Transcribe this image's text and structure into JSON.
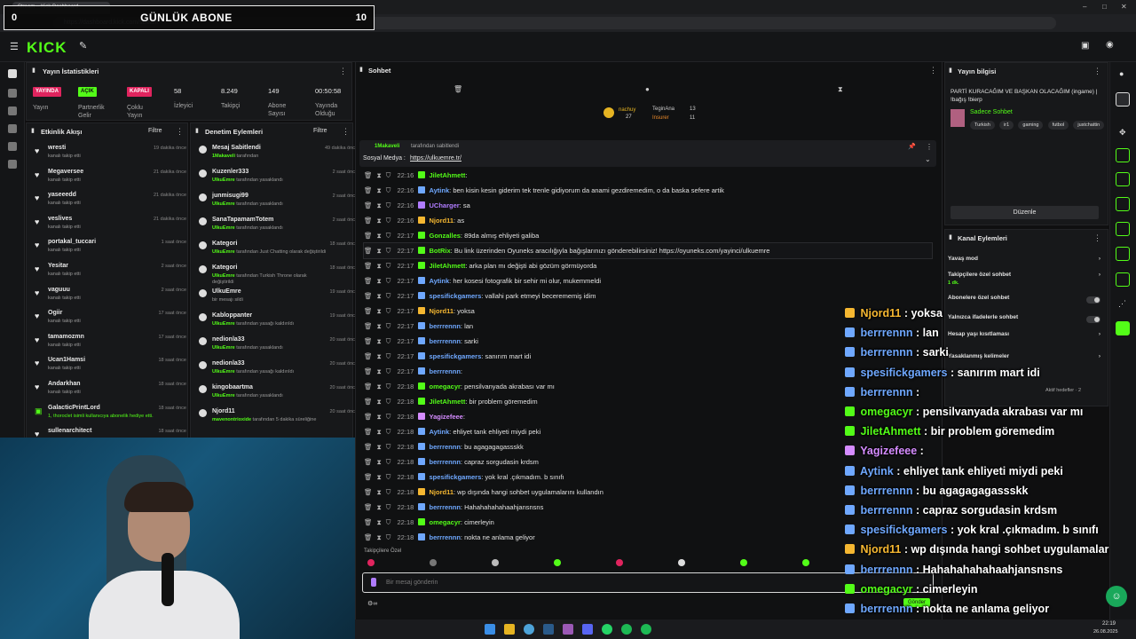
{
  "browser": {
    "tab_title": "Stream – Kick Dashboard",
    "url": "https://dashboard.kick.com/stream",
    "clock_time": "22:19",
    "clock_date": "26.08.2025"
  },
  "overlay": {
    "left_count": "0",
    "title": "GÜNLÜK ABONE",
    "right_count": "10"
  },
  "header": {
    "logo": "KICK"
  },
  "stats": {
    "title": "Yayın İstatistikleri",
    "badges": [
      {
        "label": "YAYINDA",
        "color": "#e0245e",
        "caption": "Yayın"
      },
      {
        "label": "AÇIK",
        "color": "#53fc18",
        "caption": "Partnerlik Gelir"
      },
      {
        "label": "KAPALI",
        "color": "#e0245e",
        "caption": "Çoklu Yayın"
      }
    ],
    "values": [
      {
        "value": "58",
        "label": "İzleyici"
      },
      {
        "value": "8.249",
        "label": "Takipçi"
      },
      {
        "value": "149",
        "label": "Abone Sayısı"
      },
      {
        "value": "00:50:58",
        "label": "Yayında Olduğu"
      }
    ]
  },
  "activity": {
    "title": "Etkinlik Akışı",
    "filter": "Filtre",
    "items": [
      {
        "name": "wresti",
        "sub": "kanalı takip etti",
        "time": "19 dakika önce"
      },
      {
        "name": "Megaversee",
        "sub": "kanalı takip etti",
        "time": "21 dakika önce"
      },
      {
        "name": "yaseeedd",
        "sub": "kanalı takip etti",
        "time": "21 dakika önce"
      },
      {
        "name": "veslives",
        "sub": "kanalı takip etti",
        "time": "21 dakika önce"
      },
      {
        "name": "portakal_tuccari",
        "sub": "kanalı takip etti",
        "time": "1 saat önce"
      },
      {
        "name": "Yesitar",
        "sub": "kanalı takip etti",
        "time": "2 saat önce"
      },
      {
        "name": "vaguuu",
        "sub": "kanalı takip etti",
        "time": "2 saat önce"
      },
      {
        "name": "Ogiir",
        "sub": "kanalı takip etti",
        "time": "17 saat önce"
      },
      {
        "name": "tamamozmn",
        "sub": "kanalı takip etti",
        "time": "17 saat önce"
      },
      {
        "name": "Ucan1Hamsi",
        "sub": "kanalı takip etti",
        "time": "18 saat önce"
      },
      {
        "name": "Andarkhan",
        "sub": "kanalı takip etti",
        "time": "18 saat önce"
      },
      {
        "name": "GalacticPrintLord",
        "sub": "1, thoroclet isimli kullanıcıya abonelik hediye etti.",
        "time": "18 saat önce"
      },
      {
        "name": "sullenarchitect",
        "sub": "",
        "time": "18 saat önce"
      }
    ]
  },
  "moderation": {
    "title": "Denetim Eylemleri",
    "filter": "Filtre",
    "items": [
      {
        "name": "Mesaj Sabitlendi",
        "actor": "1Makaveli",
        "sub": "tarafından",
        "time": "49 dakika önce"
      },
      {
        "name": "Kuzenler333",
        "actor": "UlkuEmre",
        "sub": "tarafından yasaklandı",
        "time": "2 saat önce"
      },
      {
        "name": "junmisugi99",
        "actor": "UlkuEmre",
        "sub": "tarafından yasaklandı",
        "time": "2 saat önce"
      },
      {
        "name": "SanaTapamamTotem",
        "actor": "UlkuEmre",
        "sub": "tarafından yasaklandı",
        "time": "2 saat önce"
      },
      {
        "name": "Kategori",
        "actor": "UlkuEmre",
        "sub": "tarafından Just Chatting olarak değiştirildi",
        "time": "18 saat önce"
      },
      {
        "name": "Kategori",
        "actor": "UlkuEmre",
        "sub": "tarafından Turkish Throne olarak değiştirildi",
        "time": "18 saat önce"
      },
      {
        "name": "UlkuEmre",
        "actor": "",
        "sub": "bir mesajı sildi",
        "time": "19 saat önce"
      },
      {
        "name": "Kabloppanter",
        "actor": "UlkuEmre",
        "sub": "tarafından yasağı kaldırıldı",
        "time": "19 saat önce"
      },
      {
        "name": "nedionla33",
        "actor": "UlkuEmre",
        "sub": "tarafından yasaklandı",
        "time": "20 saat önce"
      },
      {
        "name": "nedionla33",
        "actor": "UlkuEmre",
        "sub": "tarafından yasağı kaldırıldı",
        "time": "20 saat önce"
      },
      {
        "name": "kingobaartma",
        "actor": "UlkuEmre",
        "sub": "tarafından yasaklandı",
        "time": "20 saat önce"
      },
      {
        "name": "Njord11",
        "actor": "mavenontrioxide",
        "sub": "tarafından 5 dakika süreliğine",
        "time": "20 saat önce"
      }
    ]
  },
  "chat": {
    "title": "Sohbet",
    "top_user": "nachuy",
    "top_user_count": "27",
    "leaders": [
      {
        "name": "TeginAna",
        "count": "13"
      },
      {
        "name": "Insurer",
        "count": "11"
      }
    ],
    "pinned_by": "1Makaveli",
    "pinned_suffix": "tarafından sabitlendi",
    "pinned_label": "Sosyal Medya :",
    "pinned_link": "https://ulkuemre.tr/",
    "messages": [
      {
        "time": "22:16",
        "user": "JiletAhmett",
        "color": "#53fc18",
        "text": ""
      },
      {
        "time": "22:16",
        "user": "Aytink",
        "color": "#6fa8ff",
        "text": "ben kisin kesin giderim tek trenle gidiyorum da anami gezdiremedim, o da baska sefere artik"
      },
      {
        "time": "22:16",
        "user": "UCharger",
        "color": "#b07cff",
        "text": "sa"
      },
      {
        "time": "22:16",
        "user": "Njord11",
        "color": "#f5b731",
        "text": "as"
      },
      {
        "time": "22:17",
        "user": "Gonzalles",
        "color": "#53fc18",
        "text": "89da almış ehliyeti galiba"
      },
      {
        "time": "22:17",
        "user": "BotRix",
        "color": "#53fc18",
        "text": "Bu link üzerinden Oyuneks aracılığıyla bağışlarınızı gönderebilirsiniz! https://oyuneks.com/yayinci/ulkuemre"
      },
      {
        "time": "22:17",
        "user": "JiletAhmett",
        "color": "#53fc18",
        "text": "arka plan mı değişti abi gözüm görmüyorda"
      },
      {
        "time": "22:17",
        "user": "Aytink",
        "color": "#6fa8ff",
        "text": "her kosesi fotografik bir sehir mi olur, mukemmeldi"
      },
      {
        "time": "22:17",
        "user": "spesifickgamers",
        "color": "#6fa8ff",
        "text": "vallahi park etmeyi becerememiş idim"
      },
      {
        "time": "22:17",
        "user": "Njord11",
        "color": "#f5b731",
        "text": "yoksa"
      },
      {
        "time": "22:17",
        "user": "berrrennn",
        "color": "#6fa8ff",
        "text": "lan"
      },
      {
        "time": "22:17",
        "user": "berrrennn",
        "color": "#6fa8ff",
        "text": "sarki"
      },
      {
        "time": "22:17",
        "user": "spesifickgamers",
        "color": "#6fa8ff",
        "text": "sanırım mart idi"
      },
      {
        "time": "22:17",
        "user": "berrrennn",
        "color": "#6fa8ff",
        "text": ""
      },
      {
        "time": "22:18",
        "user": "omegacyr",
        "color": "#53fc18",
        "text": "pensilvanyada akrabası var mı"
      },
      {
        "time": "22:18",
        "user": "JiletAhmett",
        "color": "#53fc18",
        "text": "bir problem göremedim"
      },
      {
        "time": "22:18",
        "user": "Yagizefeee",
        "color": "#d58cff",
        "text": ""
      },
      {
        "time": "22:18",
        "user": "Aytink",
        "color": "#6fa8ff",
        "text": "ehliyet tank ehliyeti miydi peki"
      },
      {
        "time": "22:18",
        "user": "berrrennn",
        "color": "#6fa8ff",
        "text": "bu agagagagassskk"
      },
      {
        "time": "22:18",
        "user": "berrrennn",
        "color": "#6fa8ff",
        "text": "capraz sorgudasin krdsm"
      },
      {
        "time": "22:18",
        "user": "spesifickgamers",
        "color": "#6fa8ff",
        "text": "yok kral .çıkmadım. b sınıfı"
      },
      {
        "time": "22:18",
        "user": "Njord11",
        "color": "#f5b731",
        "text": "wp dışında hangi sohbet uygulamalarını kullandın"
      },
      {
        "time": "22:18",
        "user": "berrrennn",
        "color": "#6fa8ff",
        "text": "Hahahahahahaahjansnsns"
      },
      {
        "time": "22:18",
        "user": "omegacyr",
        "color": "#53fc18",
        "text": "cimerleyin"
      },
      {
        "time": "22:18",
        "user": "berrrennn",
        "color": "#6fa8ff",
        "text": "nokta ne anlama geliyor"
      }
    ],
    "followers_only": "Takipçilere Özel",
    "input_placeholder": "Bir mesaj gönderin",
    "send_label": "Gönder"
  },
  "stream_info": {
    "title": "Yayın bilgisi",
    "stream_title": "PARTİ KURACAĞIM VE BAŞKAN OLACAĞIM (ingame) | !bağış !bierp",
    "chat_mode": "Sadece Sohbet",
    "tags": [
      "Turkish",
      "ir1",
      "gaming",
      "futbol",
      "justchattin"
    ],
    "edit_label": "Düzenle"
  },
  "channel_actions": {
    "title": "Kanal Eylemleri",
    "rows": [
      {
        "label": "Yavaş mod",
        "sub": ""
      },
      {
        "label": "Takipçilere özel sohbet",
        "sub": "1 dk."
      },
      {
        "label": "Abonelere özel sohbet",
        "sub": ""
      },
      {
        "label": "Yalnızca ifadelerle sohbet",
        "sub": ""
      },
      {
        "label": "Hesap yaşı kısıtlaması",
        "sub": ""
      },
      {
        "label": "Yasaklanmış kelimeler",
        "sub": ""
      }
    ],
    "active_goals": "Aktif hedefler · 2"
  },
  "overlay_chat": [
    {
      "user": "Njord11",
      "color": "#f5b731",
      "text": ": yoksa"
    },
    {
      "user": "berrrennn",
      "color": "#6fa8ff",
      "text": ": lan"
    },
    {
      "user": "berrrennn",
      "color": "#6fa8ff",
      "text": ": sarki"
    },
    {
      "user": "spesifickgamers",
      "color": "#6fa8ff",
      "text": ": sanırım mart idi"
    },
    {
      "user": "berrrennn",
      "color": "#6fa8ff",
      "text": ":"
    },
    {
      "user": "omegacyr",
      "color": "#53fc18",
      "text": ": pensilvanyada akrabası var mı"
    },
    {
      "user": "JiletAhmett",
      "color": "#53fc18",
      "text": ": bir problem göremedim"
    },
    {
      "user": "Yagizefeee",
      "color": "#d58cff",
      "text": ":"
    },
    {
      "user": "Aytink",
      "color": "#6fa8ff",
      "text": ": ehliyet tank ehliyeti miydi peki"
    },
    {
      "user": "berrrennn",
      "color": "#6fa8ff",
      "text": ": bu agagagagassskk"
    },
    {
      "user": "berrrennn",
      "color": "#6fa8ff",
      "text": ": capraz sorgudasin krdsm"
    },
    {
      "user": "spesifickgamers",
      "color": "#6fa8ff",
      "text": ": yok kral .çıkmadım. b sınıfı"
    },
    {
      "user": "Njord11",
      "color": "#f5b731",
      "text": ": wp dışında hangi sohbet uygulamalarını kullandın"
    },
    {
      "user": "berrrennn",
      "color": "#6fa8ff",
      "text": ": Hahahahahahaahjansnsns"
    },
    {
      "user": "omegacyr",
      "color": "#53fc18",
      "text": ": cimerleyin"
    },
    {
      "user": "berrrennn",
      "color": "#6fa8ff",
      "text": ": nokta ne anlama geliyor"
    }
  ],
  "colors": {
    "accent": "#53fc18",
    "live": "#e0245e",
    "panel": "#17181a",
    "bg": "#0f0f10"
  }
}
